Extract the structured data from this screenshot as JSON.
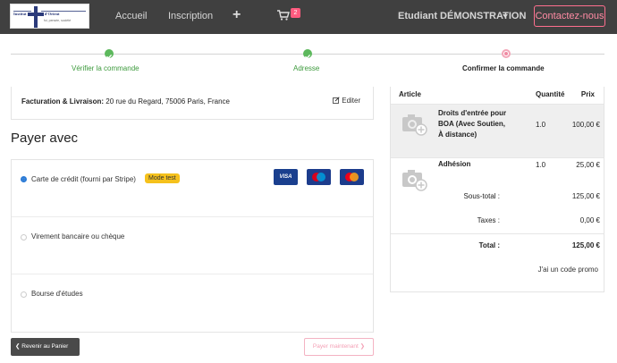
{
  "navbar": {
    "logo_title": "Institut chrétiens d'Orient",
    "logo_subtitle": "foi, pensée, société",
    "links": [
      "Accueil",
      "Inscription"
    ],
    "plus_icon": "plus-icon",
    "cart_icon": "cart-icon",
    "cart_count": "2",
    "user": "Etudiant DÉMONSTRATION",
    "contact": "Contactez-nous"
  },
  "steps": [
    {
      "label": "Vérifier la commande",
      "state": "done"
    },
    {
      "label": "Adresse",
      "state": "done"
    },
    {
      "label": "Confirmer la commande",
      "state": "current"
    }
  ],
  "billing": {
    "label": "Facturation & Livraison:",
    "address": " 20 rue du Regard, 75006 Paris, France",
    "edit": "Editer"
  },
  "payment": {
    "title": "Payer avec",
    "options": [
      {
        "label": "Carte de crédit (fourni par Stripe)",
        "badge": "Mode test",
        "checked": true
      },
      {
        "label": "Virement bancaire ou chèque",
        "checked": false
      },
      {
        "label": "Bourse d'études",
        "checked": false
      }
    ],
    "cards": [
      "VISA",
      "maestro",
      "mastercard"
    ]
  },
  "actions": {
    "back": "Revenir au Panier",
    "pay": "Payer maintenant"
  },
  "summary": {
    "headers": {
      "article": "Article",
      "qty": "Quantité",
      "price": "Prix"
    },
    "items": [
      {
        "name": "Droits d'entrée pour BOA (Avec Soutien, À distance)",
        "qty": "1.0",
        "price": "100,00 €"
      },
      {
        "name": "Adhésion",
        "qty": "1.0",
        "price": "25,00 €"
      }
    ],
    "subtotal_label": "Sous-total :",
    "subtotal": "125,00 €",
    "taxes_label": "Taxes :",
    "taxes": "0,00 €",
    "total_label": "Total :",
    "total": "125,00 €",
    "promo": "J'ai un code promo"
  },
  "colors": {
    "navbar": "#404040",
    "accent_pink": "#ff6f8f",
    "success_green": "#5cb85c",
    "radio_blue": "#2b7bd6",
    "badge_yellow": "#f5c11c"
  }
}
